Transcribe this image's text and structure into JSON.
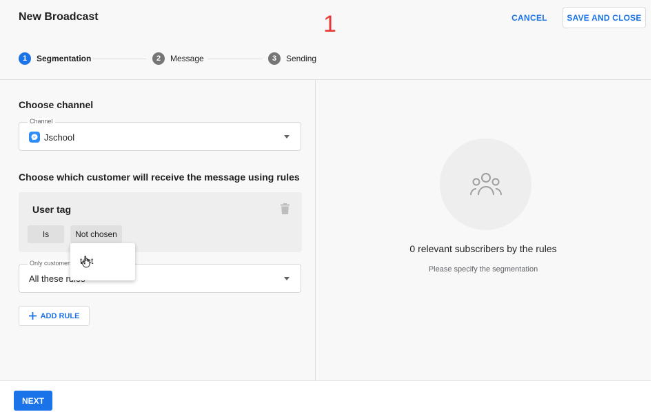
{
  "header": {
    "title": "New Broadcast",
    "annotation": "1",
    "cancel_label": "CANCEL",
    "save_close_label": "SAVE AND CLOSE"
  },
  "stepper": {
    "steps": [
      {
        "number": "1",
        "label": "Segmentation",
        "state": "active"
      },
      {
        "number": "2",
        "label": "Message",
        "state": "inactive"
      },
      {
        "number": "3",
        "label": "Sending",
        "state": "inactive"
      }
    ]
  },
  "channel_section": {
    "title": "Choose channel",
    "field_label": "Channel",
    "value": "Jschool",
    "icon": "messenger-icon"
  },
  "rules_section": {
    "title": "Choose which customer will receive the message using rules",
    "rule": {
      "title": "User tag",
      "operator": "Is",
      "value": "Not chosen"
    },
    "dropdown_item": "test",
    "match_field_label": "Only customers",
    "match_value": "All these rules",
    "add_rule_label": "ADD RULE"
  },
  "summary": {
    "title": "0 relevant subscribers by the rules",
    "subtitle": "Please specify the segmentation",
    "icon": "people-group-icon"
  },
  "footer": {
    "next_label": "NEXT"
  },
  "colors": {
    "accent": "#1a73e8",
    "annotation": "#e53935"
  }
}
